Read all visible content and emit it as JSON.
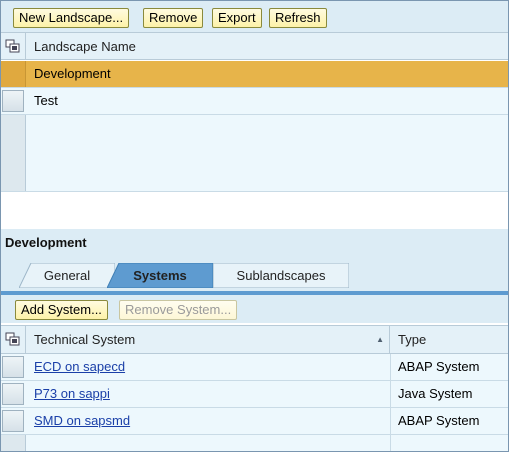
{
  "toolbar": {
    "new_landscape": "New Landscape...",
    "remove": "Remove",
    "export": "Export",
    "refresh": "Refresh"
  },
  "landscapes": {
    "column_header": "Landscape Name",
    "rows": [
      {
        "name": "Development",
        "selected": true
      },
      {
        "name": "Test",
        "selected": false
      }
    ]
  },
  "detail": {
    "title": "Development",
    "tabs": [
      {
        "label": "General",
        "active": false
      },
      {
        "label": "Systems",
        "active": true
      },
      {
        "label": "Sublandscapes",
        "active": false
      }
    ],
    "toolbar": {
      "add_system": "Add System...",
      "remove_system": "Remove System..."
    },
    "systems_table": {
      "col_system": "Technical System",
      "col_type": "Type",
      "sort_indicator": "▲",
      "rows": [
        {
          "system": "ECD on sapecd",
          "type": "ABAP System"
        },
        {
          "system": "P73 on sappi",
          "type": "Java System"
        },
        {
          "system": "SMD on sapsmd",
          "type": "ABAP System"
        }
      ]
    }
  },
  "colors": {
    "selected_row": "#e7b44a",
    "button_bg": "#fdf2a8",
    "tab_active": "#5e9bd0",
    "link": "#1a3fa8"
  },
  "icons": {
    "select_all": "select-all-icon",
    "sort": "sort-ascending-icon"
  }
}
